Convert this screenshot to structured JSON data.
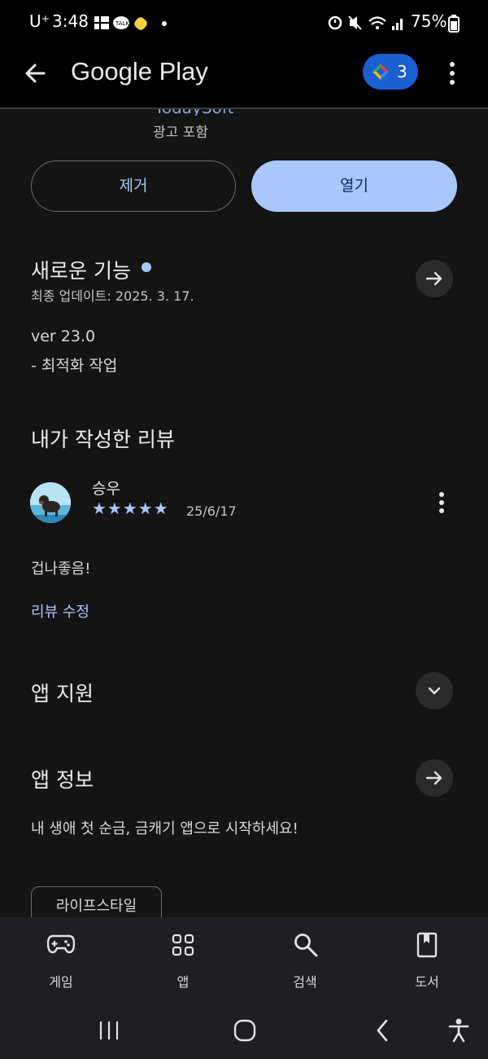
{
  "status": {
    "carrier": "U⁺",
    "time": "3:48",
    "battery": "75%"
  },
  "header": {
    "title": "Google Play",
    "points_count": "3"
  },
  "app": {
    "developer_partial": "TodaySoft",
    "ads_label": "광고 포함"
  },
  "actions": {
    "uninstall_label": "제거",
    "open_label": "열기"
  },
  "whats_new": {
    "title": "새로운 기능",
    "last_updated": "최종 업데이트: 2025. 3. 17.",
    "version": "ver 23.0",
    "notes": "- 최적화 작업"
  },
  "my_review": {
    "title": "내가 작성한 리뷰",
    "author": "승우",
    "stars": "★★★★★",
    "rating": 5,
    "date": "25/6/17",
    "text": "겁나좋음!",
    "edit_label": "리뷰 수정"
  },
  "app_support": {
    "title": "앱 지원"
  },
  "app_info": {
    "title": "앱 정보",
    "description": "내 생애 첫 순금, 금캐기 앱으로 시작하세요!",
    "category_chip": "라이프스타일"
  },
  "bottom_nav": {
    "games": "게임",
    "apps": "앱",
    "search": "검색",
    "books": "도서"
  },
  "colors": {
    "accent": "#a8c7fa",
    "background": "#141414",
    "badge": "#1a5fd1"
  }
}
